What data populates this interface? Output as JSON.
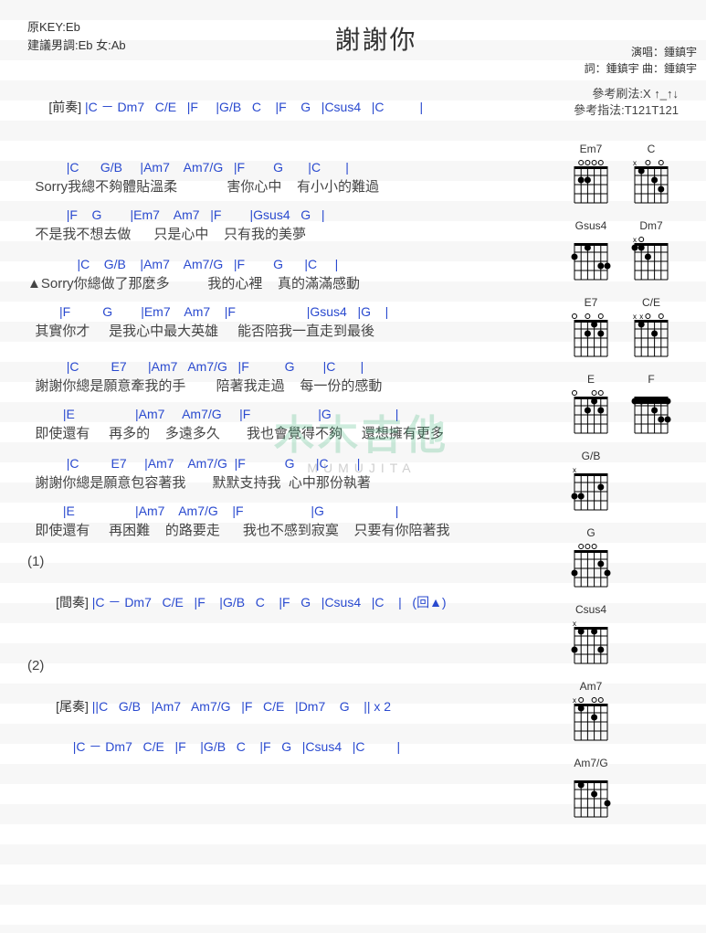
{
  "header": {
    "original_key": "原KEY:Eb",
    "suggest": "建議男調:Eb 女:Ab",
    "title": "謝謝你",
    "perf": "演唱：鍾鎮宇",
    "credits": "詞：鍾鎮宇  曲：鍾鎮宇",
    "ref_strum": "參考刷法:X ↑_↑↓",
    "ref_finger": "參考指法:T121T121"
  },
  "intro": {
    "tag": "[前奏]",
    "chords": " |C － Dm7   C/E   |F     |G/B   C    |F    G   |Csus4   |C          |"
  },
  "verses": [
    {
      "chords": "           |C      G/B     |Am7    Am7/G   |F        G       |C       |",
      "lyric": "  Sorry我總不夠體貼溫柔             害你心中    有小小的難過"
    },
    {
      "chords": "           |F    G        |Em7    Am7   |F        |Gsus4   G   |",
      "lyric": "  不是我不想去做      只是心中    只有我的美夢"
    },
    {
      "chords": "              |C    G/B    |Am7    Am7/G   |F        G      |C     |",
      "lyric": "▲Sorry你總做了那麼多          我的心裡    真的滿滿感動"
    },
    {
      "chords": "         |F         G        |Em7    Am7    |F                    |Gsus4   |G    |",
      "lyric": "  其實你才     是我心中最大英雄     能否陪我一直走到最後"
    },
    {
      "chords": "           |C         E7      |Am7   Am7/G   |F          G        |C       |",
      "lyric": "  謝謝你總是願意牽我的手        陪著我走過    每一份的感動"
    },
    {
      "chords": "          |E                 |Am7     Am7/G     |F                   |G                  |",
      "lyric": "  即使還有     再多的    多遠多久       我也會覺得不夠     還想擁有更多"
    },
    {
      "chords": "           |C         E7     |Am7    Am7/G  |F           G      |C        |",
      "lyric": "  謝謝你總是願意包容著我       默默支持我  心中那份執著"
    },
    {
      "chords": "          |E                 |Am7    Am7/G    |F                   |G                    |",
      "lyric": "  即使還有     再困難    的路要走      我也不感到寂寞    只要有你陪著我"
    }
  ],
  "marker1": "(1)",
  "interlude": {
    "tag": "[間奏]",
    "chords": " |C － Dm7   C/E   |F    |G/B   C    |F   G   |Csus4   |C    |   (回▲)"
  },
  "marker2": "(2)",
  "outro": {
    "tag": "[尾奏]",
    "line1": " ||C   G/B   |Am7   Am7/G   |F   C/E   |Dm7    G    || x 2",
    "line2": "  |C － Dm7   C/E   |F    |G/B   C    |F   G   |Csus4   |C         |"
  },
  "diagrams": [
    [
      {
        "name": "Em7"
      },
      {
        "name": "C"
      }
    ],
    [
      {
        "name": "Gsus4"
      },
      {
        "name": "Dm7"
      }
    ],
    [
      {
        "name": "E7"
      },
      {
        "name": "C/E"
      }
    ],
    [
      {
        "name": "E"
      },
      {
        "name": "F"
      }
    ],
    [
      {
        "name": "G/B"
      }
    ],
    [
      {
        "name": "G"
      }
    ],
    [
      {
        "name": "Csus4"
      }
    ],
    [
      {
        "name": "Am7"
      }
    ],
    [
      {
        "name": "Am7/G"
      }
    ]
  ],
  "watermark": {
    "main": "木木吉他",
    "sub": "MUMUJITA"
  },
  "chord_shapes": {
    "Em7": {
      "open": "  o o o o",
      "dots": [
        [
          2,
          2
        ],
        [
          2,
          3
        ]
      ]
    },
    "C": {
      "open": "x   o   o",
      "dots": [
        [
          1,
          2
        ],
        [
          2,
          4
        ],
        [
          3,
          5
        ]
      ]
    },
    "Gsus4": {
      "open": "       ",
      "dots": [
        [
          2,
          1
        ],
        [
          3,
          5
        ],
        [
          3,
          6
        ],
        [
          1,
          3
        ]
      ]
    },
    "Dm7": {
      "open": "x o    ",
      "dots": [
        [
          1,
          1
        ],
        [
          1,
          2
        ],
        [
          2,
          3
        ]
      ]
    },
    "E7": {
      "open": "o   o   o",
      "dots": [
        [
          1,
          4
        ],
        [
          2,
          5
        ],
        [
          2,
          3
        ]
      ]
    },
    "C/E": {
      "open": "x x o   o",
      "dots": [
        [
          1,
          2
        ],
        [
          2,
          4
        ]
      ]
    },
    "E": {
      "open": "o     o o",
      "dots": [
        [
          1,
          4
        ],
        [
          2,
          5
        ],
        [
          2,
          3
        ]
      ]
    },
    "F": {
      "open": "       ",
      "dots": [
        [
          1,
          1
        ],
        [
          1,
          2
        ],
        [
          2,
          4
        ],
        [
          3,
          5
        ],
        [
          3,
          6
        ],
        [
          1,
          6
        ]
      ],
      "barre": 1
    },
    "G/B": {
      "open": "x       ",
      "dots": [
        [
          2,
          5
        ],
        [
          3,
          1
        ],
        [
          3,
          2
        ]
      ]
    },
    "G": {
      "open": "  o o o  ",
      "dots": [
        [
          2,
          5
        ],
        [
          3,
          6
        ],
        [
          3,
          1
        ]
      ]
    },
    "Csus4": {
      "open": "x        ",
      "dots": [
        [
          1,
          2
        ],
        [
          1,
          4
        ],
        [
          3,
          5
        ],
        [
          3,
          1
        ]
      ]
    },
    "Am7": {
      "open": "x o   o o",
      "dots": [
        [
          1,
          2
        ],
        [
          2,
          4
        ]
      ]
    },
    "Am7/G": {
      "open": "     o  ",
      "dots": [
        [
          1,
          2
        ],
        [
          2,
          4
        ],
        [
          3,
          6
        ]
      ]
    }
  }
}
